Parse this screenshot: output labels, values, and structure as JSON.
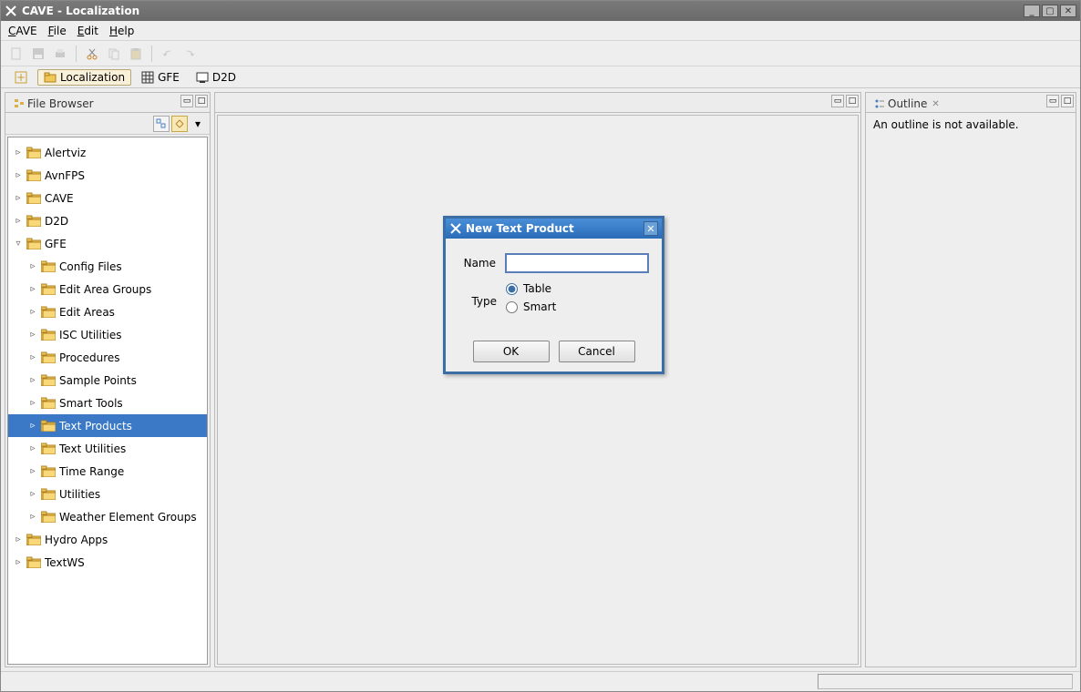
{
  "window": {
    "title": "CAVE - Localization"
  },
  "menu": {
    "cave": "CAVE",
    "file": "File",
    "edit": "Edit",
    "help": "Help"
  },
  "perspectives": {
    "localization": "Localization",
    "gfe": "GFE",
    "d2d": "D2D"
  },
  "file_browser": {
    "title": "File Browser"
  },
  "tree": {
    "items": [
      {
        "label": "Alertviz",
        "expanded": false,
        "indent": 0
      },
      {
        "label": "AvnFPS",
        "expanded": false,
        "indent": 0
      },
      {
        "label": "CAVE",
        "expanded": false,
        "indent": 0
      },
      {
        "label": "D2D",
        "expanded": false,
        "indent": 0
      },
      {
        "label": "GFE",
        "expanded": true,
        "indent": 0
      },
      {
        "label": "Config Files",
        "expanded": false,
        "indent": 1
      },
      {
        "label": "Edit Area Groups",
        "expanded": false,
        "indent": 1
      },
      {
        "label": "Edit Areas",
        "expanded": false,
        "indent": 1
      },
      {
        "label": "ISC Utilities",
        "expanded": false,
        "indent": 1
      },
      {
        "label": "Procedures",
        "expanded": false,
        "indent": 1
      },
      {
        "label": "Sample Points",
        "expanded": false,
        "indent": 1
      },
      {
        "label": "Smart Tools",
        "expanded": false,
        "indent": 1
      },
      {
        "label": "Text Products",
        "expanded": false,
        "indent": 1,
        "selected": true
      },
      {
        "label": "Text Utilities",
        "expanded": false,
        "indent": 1
      },
      {
        "label": "Time Range",
        "expanded": false,
        "indent": 1
      },
      {
        "label": "Utilities",
        "expanded": false,
        "indent": 1
      },
      {
        "label": "Weather Element Groups",
        "expanded": false,
        "indent": 1
      },
      {
        "label": "Hydro Apps",
        "expanded": false,
        "indent": 0
      },
      {
        "label": "TextWS",
        "expanded": false,
        "indent": 0
      }
    ]
  },
  "outline": {
    "title": "Outline",
    "message": "An outline is not available."
  },
  "dialog": {
    "title": "New Text Product",
    "name_label": "Name",
    "name_value": "",
    "type_label": "Type",
    "radio_table": "Table",
    "radio_smart": "Smart",
    "ok": "OK",
    "cancel": "Cancel"
  }
}
